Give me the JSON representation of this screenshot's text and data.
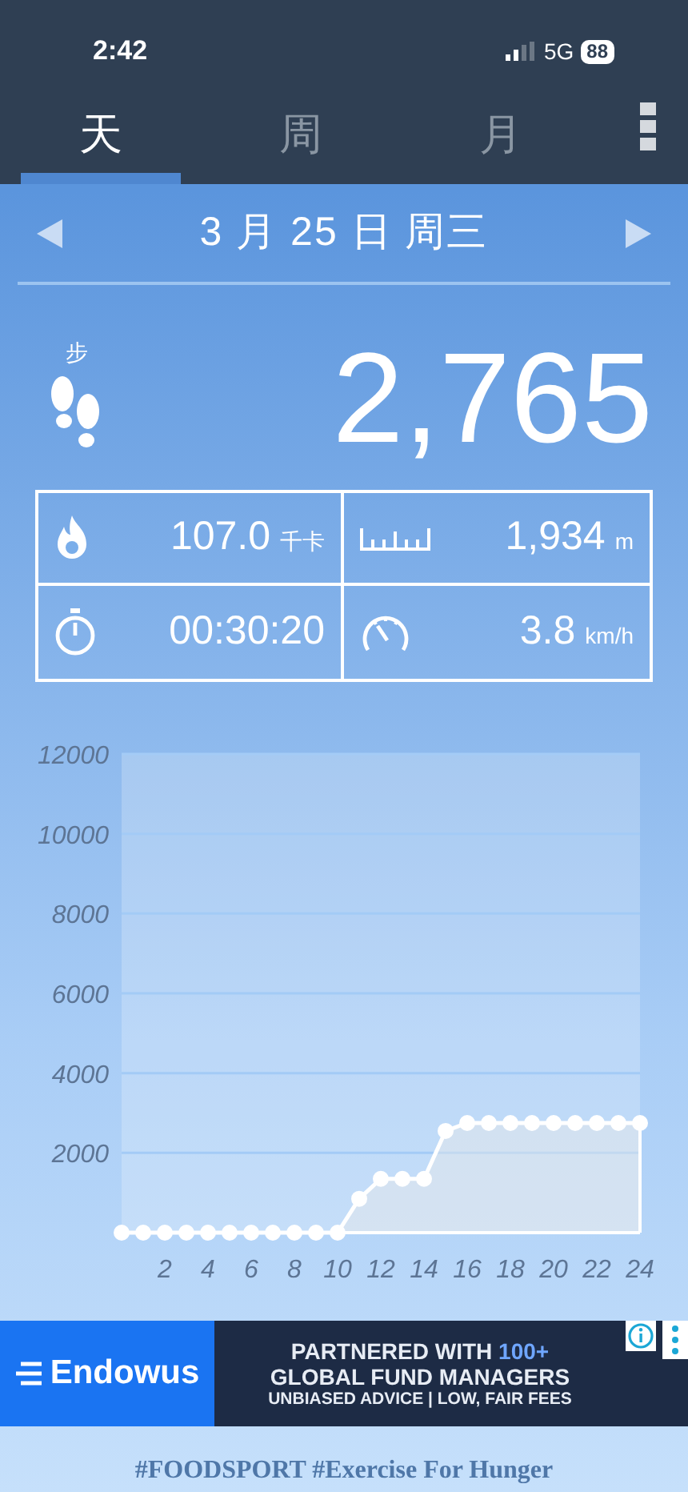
{
  "status_bar": {
    "time": "2:42",
    "network": "5G",
    "battery": "88"
  },
  "tabs": [
    {
      "label": "天",
      "selected": true
    },
    {
      "label": "周",
      "selected": false
    },
    {
      "label": "月",
      "selected": false
    }
  ],
  "date_nav": {
    "date": "3 月 25 日 周三"
  },
  "steps": {
    "label": "步",
    "value": "2,765"
  },
  "stats": [
    {
      "kind": "calories",
      "value": "107.0",
      "unit": "千卡"
    },
    {
      "kind": "distance",
      "value": "1,934",
      "unit": "m"
    },
    {
      "kind": "duration",
      "value": "00:30:20"
    },
    {
      "kind": "speed",
      "value": "3.8",
      "unit": "km/h"
    }
  ],
  "chart_data": {
    "type": "area",
    "x": [
      0,
      1,
      2,
      3,
      4,
      5,
      6,
      7,
      8,
      9,
      10,
      11,
      12,
      13,
      14,
      15,
      16,
      17,
      18,
      19,
      20,
      21,
      22,
      23,
      24
    ],
    "series": [
      {
        "color": "#ffffff",
        "values": [
          0,
          0,
          0,
          0,
          0,
          0,
          0,
          0,
          0,
          0,
          0,
          850,
          1350,
          1350,
          1350,
          2550,
          2750,
          2750,
          2750,
          2750,
          2750,
          2750,
          2750,
          2750,
          2750
        ]
      }
    ],
    "grid": true,
    "xlim": [
      0,
      24
    ],
    "ylim": [
      0,
      12000
    ],
    "xticks": [
      2,
      4,
      6,
      8,
      10,
      12,
      14,
      16,
      18,
      20,
      22,
      24
    ],
    "yticks": [
      2000,
      4000,
      6000,
      8000,
      10000,
      12000
    ]
  },
  "ad": {
    "brand": "Endowus",
    "headline": "PARTNERED WITH",
    "highlight": "100+",
    "line2": "GLOBAL FUND MANAGERS",
    "line3": "UNBIASED ADVICE | LOW, FAIR FEES"
  },
  "footer": "#FOODSPORT #Exercise For Hunger"
}
